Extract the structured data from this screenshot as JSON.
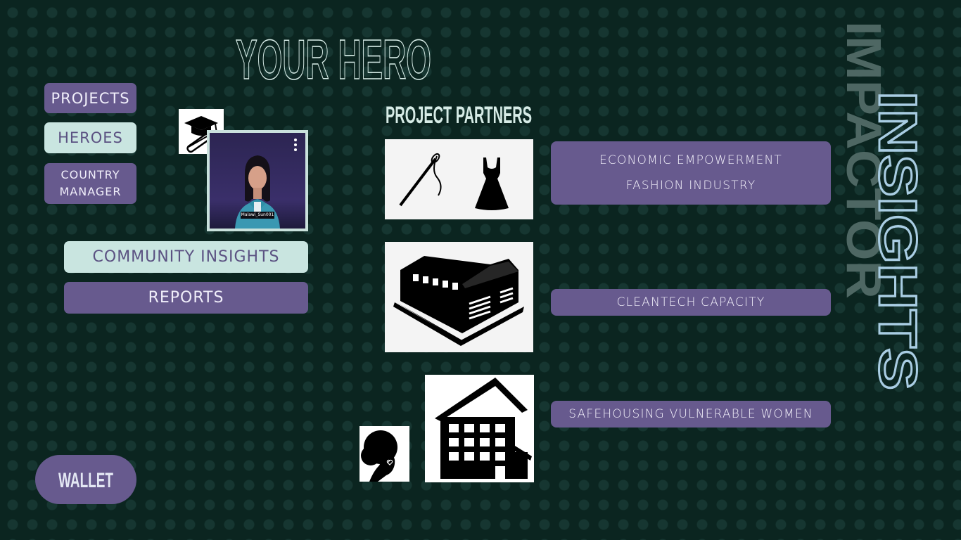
{
  "header": {
    "title": "YOUR HERO"
  },
  "sidebar": {
    "items": [
      {
        "label": "PROJECTS"
      },
      {
        "label": "HEROES"
      },
      {
        "label": "COUNTRY MANAGER"
      }
    ]
  },
  "hero": {
    "username": "Malawi_Sun001"
  },
  "menu": {
    "community_insights": "COMMUNITY INSIGHTS",
    "reports": "REPORTS"
  },
  "partners": {
    "title": "PROJECT PARTNERS",
    "items": [
      {
        "label_1": "ECONOMIC EMPOWERMENT",
        "label_2": "FASHION INDUSTRY"
      },
      {
        "label_1": "CLEANTECH CAPACITY"
      },
      {
        "label_1": "SAFEHOUSING VULNERABLE WOMEN"
      }
    ]
  },
  "side_vertical": {
    "impactor": "IMPACTOR",
    "insights": "INSIGHTS"
  },
  "wallet": {
    "label": "WALLET"
  },
  "colors": {
    "background": "#0b2520",
    "purple": "#675a8e",
    "mint": "#c9e5e0",
    "outline_blue": "#a9cde3"
  }
}
